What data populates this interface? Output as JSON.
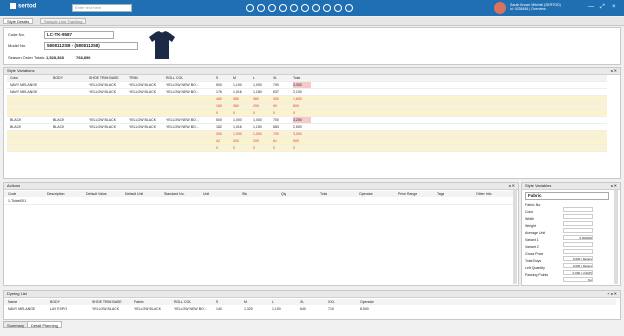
{
  "app": {
    "logo_text": "sertod",
    "search_placeholder": "Enter text here",
    "user_line1": "Sarah Brown Mitchell (SERTOD)",
    "user_line2": "id: 9238456 | Overview",
    "minimize": "—",
    "maximize": "⤢",
    "close": "×"
  },
  "tabs": [
    {
      "label": "Style Details"
    },
    {
      "label": "Sample Line Tracking"
    }
  ],
  "header": {
    "code_label": "Code No.",
    "code_value": "LC-TK-9587",
    "model_label": "Model No.",
    "model_value": "5808112SB - (580811258)",
    "season_label": "Season Order Totals",
    "season_value": "1,528,368",
    "season_extra": "768,896"
  },
  "grid": {
    "section_title": "Style Variations",
    "headers": [
      "Color",
      "BODY",
      "SHOE TRIM BASE",
      "TRIM",
      "ROLL COL",
      "S",
      "M",
      "L",
      "XL",
      "Total"
    ],
    "rows": [
      {
        "c": [
          "NAVY MELANGE",
          "",
          "YELLOW BLACK",
          "YELLOW BLACK",
          "YELLOW NEW BO...",
          "500",
          "1,100",
          "1,000",
          "700",
          "3,300"
        ],
        "sel": true
      },
      {
        "c": [
          "NAVY MELANGE",
          "",
          "YELLOW BLACK",
          "YELLOW BLACK",
          "YELLOW NEW BO...",
          "176",
          "1,016",
          "1,180",
          "637",
          "2,100"
        ]
      },
      {
        "c": [
          "",
          "",
          "",
          "",
          "",
          "460",
          "380",
          "360",
          "400",
          "1,600"
        ],
        "band": true
      },
      {
        "c": [
          "",
          "",
          "",
          "",
          "",
          "160",
          "360",
          "200",
          "90",
          "800"
        ],
        "band": true
      },
      {
        "c": [
          "",
          "",
          "",
          "",
          "",
          "0",
          "0",
          "0",
          "0",
          "0"
        ],
        "band": true
      },
      {
        "c": [
          "BLACK",
          "BLACK",
          "YELLOW BLACK",
          "YELLOW BLACK",
          "YELLOW NEW BO...",
          "500",
          "1,000",
          "1,000",
          "700",
          "3,200"
        ],
        "sel": true
      },
      {
        "c": [
          "BLACK",
          "BLACK",
          "YELLOW BLACK",
          "YELLOW BLACK",
          "YELLOW NEW BO...",
          "182",
          "1,016",
          "1,150",
          "683",
          "2,500"
        ]
      },
      {
        "c": [
          "",
          "",
          "",
          "",
          "",
          "300",
          "1,000",
          "1,000",
          "700",
          "3,000"
        ],
        "band": true
      },
      {
        "c": [
          "",
          "",
          "",
          "",
          "",
          "42",
          "200",
          "200",
          "61",
          "500"
        ],
        "band": true
      },
      {
        "c": [
          "",
          "",
          "",
          "",
          "",
          "0",
          "0",
          "0",
          "0",
          "0"
        ],
        "band": true
      }
    ]
  },
  "summary": {
    "labels": [
      "Order",
      "Sample/TOTAL",
      "Factory",
      "Stock",
      "Rank"
    ],
    "values": [
      [
        "1400",
        "2200",
        "2000",
        "1400",
        "6400"
      ],
      [
        "1154",
        "2007",
        "2350",
        "1166",
        "7000"
      ],
      [
        "1000",
        "1600",
        "1600",
        "1000",
        "4800"
      ],
      [
        "246",
        "870",
        "750",
        "0",
        "1860"
      ],
      [
        "4",
        "4",
        "4",
        "4",
        "4"
      ]
    ]
  },
  "lower": {
    "section_title": "Actions",
    "headers": [
      "Code",
      "Description",
      "Default Value",
      "Default Unit",
      "Standard No.",
      "Unit",
      "Stk",
      "Qty",
      "Total",
      "Operator",
      "Price Range",
      "Tags",
      "Other Info"
    ],
    "first_row": [
      "1-Ticket001",
      "",
      "",
      "",
      "",
      "",
      "",
      "",
      "",
      "",
      "",
      "",
      ""
    ]
  },
  "props": {
    "title": "Style Variables",
    "selected": "Fabric",
    "rows": [
      {
        "k": "Fabric No.",
        "v": ""
      },
      {
        "k": "Color",
        "v": ""
      },
      {
        "k": "Width",
        "v": ""
      },
      {
        "k": "Weight",
        "v": ""
      },
      {
        "k": "Average Unit",
        "v": "0.000000"
      },
      {
        "k": "Variant 1",
        "v": ""
      },
      {
        "k": "Variant 2",
        "v": ""
      },
      {
        "k": "Gross Price",
        "v": "0.000 / Meters"
      },
      {
        "k": "Total Buys",
        "v": "0.000 / Meters"
      },
      {
        "k": "Left Quantity",
        "v": "0.000 / Unit(P)"
      },
      {
        "k": "Passing Points",
        "v": "No"
      }
    ]
  },
  "footer_grid": {
    "title": "Dyeing List",
    "headers": [
      "Name",
      "BODY",
      "SHOE TRIM BASE",
      "Fabric",
      "ROLL COL",
      "S",
      "M",
      "L",
      "XL",
      "XXL",
      "Operator"
    ],
    "row": [
      "NAVY MELANGE",
      "LAY EXPO",
      "YELLOW BLACK",
      "YELLOW BLACK",
      "YELLOW NEW BO...",
      "140",
      "1,320",
      "1,100",
      "640",
      "710",
      "8,500"
    ]
  },
  "bottom_tabs": [
    {
      "label": "Summary"
    },
    {
      "label": "Detail Planning"
    }
  ],
  "colors": {
    "accent": "#1f6fb2",
    "nav": "#2a3a8a",
    "band": "#fbf3cf",
    "alert": "#d43c3c"
  }
}
